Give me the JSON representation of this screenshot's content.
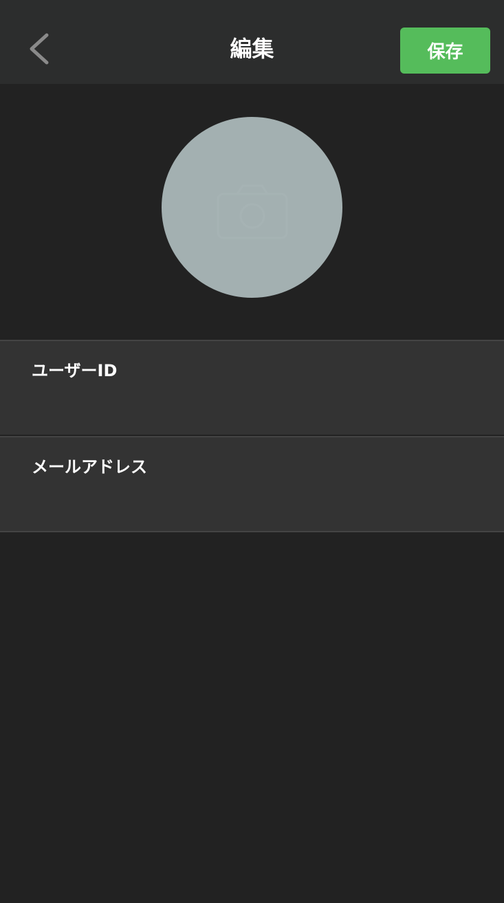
{
  "header": {
    "title": "編集",
    "save_label": "保存"
  },
  "profile": {
    "avatar_icon": "camera-icon"
  },
  "fields": {
    "user_id": {
      "label": "ユーザーID",
      "value": ""
    },
    "email": {
      "label": "メールアドレス",
      "value": ""
    }
  },
  "colors": {
    "background": "#222222",
    "nav_bar": "#2c2d2d",
    "accent_green": "#55bc5b",
    "avatar": "#a3b0b1",
    "field_row": "#333333",
    "divider": "#444444",
    "back_icon": "#8a8a8a"
  }
}
